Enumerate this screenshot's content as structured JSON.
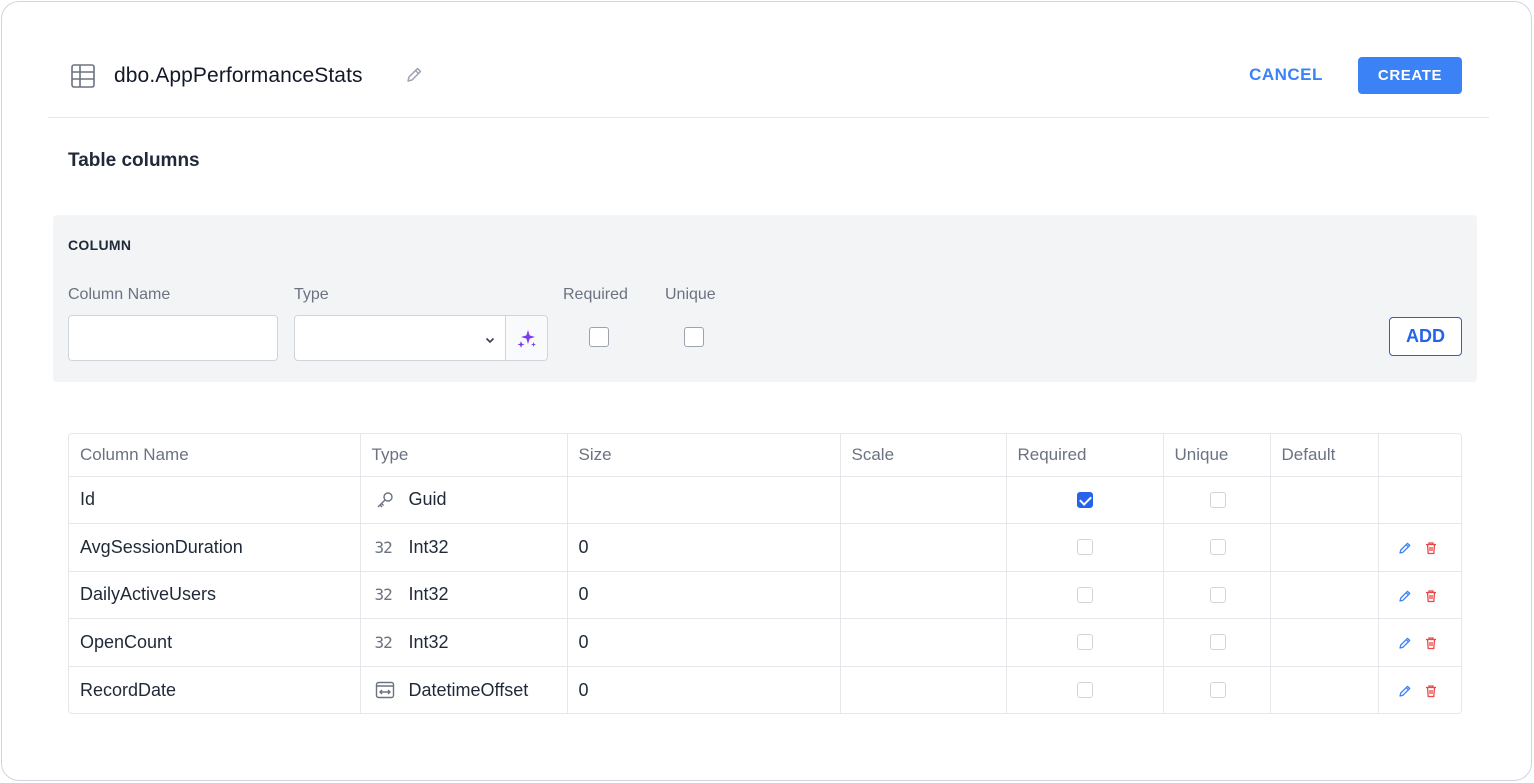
{
  "header": {
    "title": "dbo.AppPerformanceStats",
    "cancel_label": "CANCEL",
    "create_label": "CREATE"
  },
  "section_title": "Table columns",
  "new_column": {
    "panel_title": "COLUMN",
    "name_label": "Column Name",
    "name_value": "",
    "type_label": "Type",
    "type_value": "",
    "required_label": "Required",
    "required_checked": false,
    "unique_label": "Unique",
    "unique_checked": false,
    "add_label": "ADD"
  },
  "columns_table": {
    "headers": [
      "Column Name",
      "Type",
      "Size",
      "Scale",
      "Required",
      "Unique",
      "Default",
      ""
    ],
    "rows": [
      {
        "name": "Id",
        "type": "Guid",
        "type_icon": "key-icon",
        "size": "",
        "scale": "",
        "required": true,
        "unique": false,
        "default": "",
        "editable": false
      },
      {
        "name": "AvgSessionDuration",
        "type": "Int32",
        "type_icon": "number-icon",
        "size": "0",
        "scale": "",
        "required": false,
        "unique": false,
        "default": "",
        "editable": true
      },
      {
        "name": "DailyActiveUsers",
        "type": "Int32",
        "type_icon": "number-icon",
        "size": "0",
        "scale": "",
        "required": false,
        "unique": false,
        "default": "",
        "editable": true
      },
      {
        "name": "OpenCount",
        "type": "Int32",
        "type_icon": "number-icon",
        "size": "0",
        "scale": "",
        "required": false,
        "unique": false,
        "default": "",
        "editable": true
      },
      {
        "name": "RecordDate",
        "type": "DatetimeOffset",
        "type_icon": "datetime-icon",
        "size": "0",
        "scale": "",
        "required": false,
        "unique": false,
        "default": "",
        "editable": true
      }
    ]
  },
  "colors": {
    "accent": "#3b82f6",
    "delete": "#ef4444",
    "ai": "#7c3aed"
  }
}
